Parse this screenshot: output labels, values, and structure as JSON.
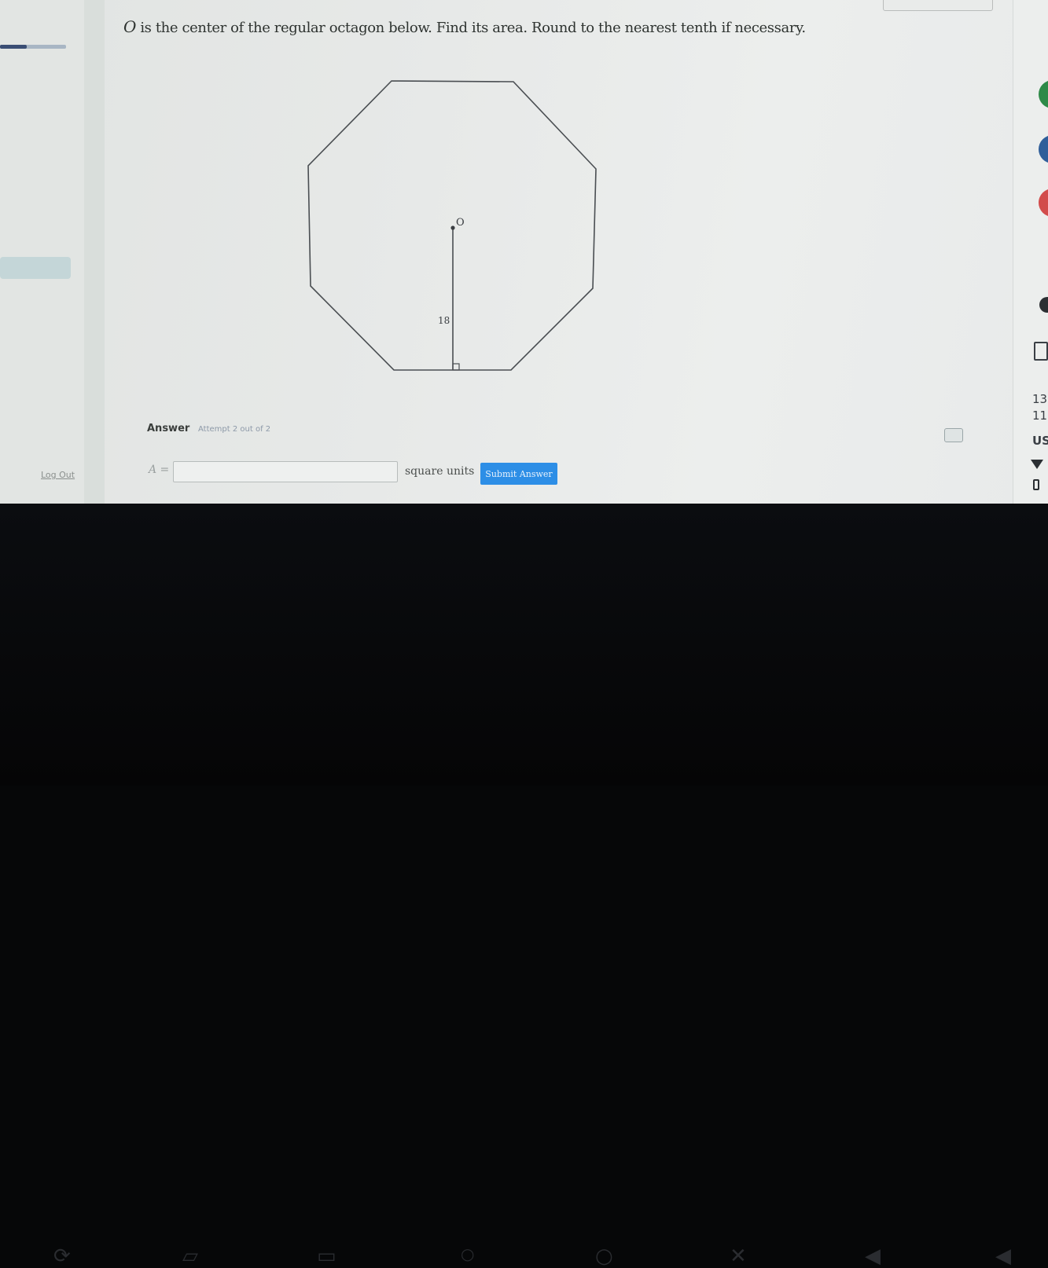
{
  "question": {
    "variable": "O",
    "text": "is the center of the regular octagon below. Find its area. Round to the nearest tenth if necessary."
  },
  "figure": {
    "center_label": "O",
    "apothem_label": "18"
  },
  "answer": {
    "heading": "Answer",
    "attempt_text": "Attempt 2 out of 2",
    "variable_label": "A =",
    "input_value": "",
    "units": "square units",
    "submit_label": "Submit Answer"
  },
  "sidebar": {
    "logout_label": "Log Out",
    "progress": 0.4
  },
  "shelf": {
    "tray_texts": [
      "13",
      "11",
      "US"
    ]
  },
  "colors": {
    "submit": "#2d8ee6",
    "progress": "#3a4e74"
  }
}
